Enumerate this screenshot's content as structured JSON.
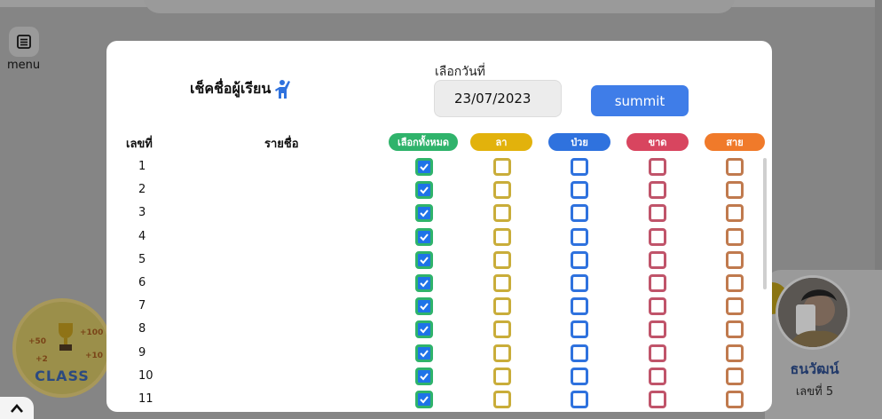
{
  "menu": {
    "label": "menu",
    "icon": "list-icon"
  },
  "badge": {
    "text": "CLASS",
    "numbers": [
      "+50",
      "+100",
      "+2",
      "+10"
    ]
  },
  "student_card": {
    "name": "ธนวัฒน์",
    "number_label": "เลขที่ 5"
  },
  "modal": {
    "title": "เช็คชื่อผู้เรียน",
    "date_label": "เลือกวันที่",
    "date_value": "23/07/2023",
    "submit_label": "summit",
    "columns": {
      "number": "เลขที่",
      "name": "รายชื่อ",
      "select_all": "เลือกทั้งหมด",
      "leave": "ลา",
      "sick": "ป่วย",
      "absent": "ขาด",
      "late": "สาย"
    },
    "rows": [
      "1",
      "2",
      "3",
      "4",
      "5",
      "6",
      "7",
      "8",
      "9",
      "10",
      "11"
    ]
  },
  "colors": {
    "select_all": "#2fb36b",
    "leave": "#e2b20c",
    "sick": "#2f72de",
    "absent": "#d8455f",
    "late": "#f07a2a",
    "submit": "#3f7de8"
  }
}
